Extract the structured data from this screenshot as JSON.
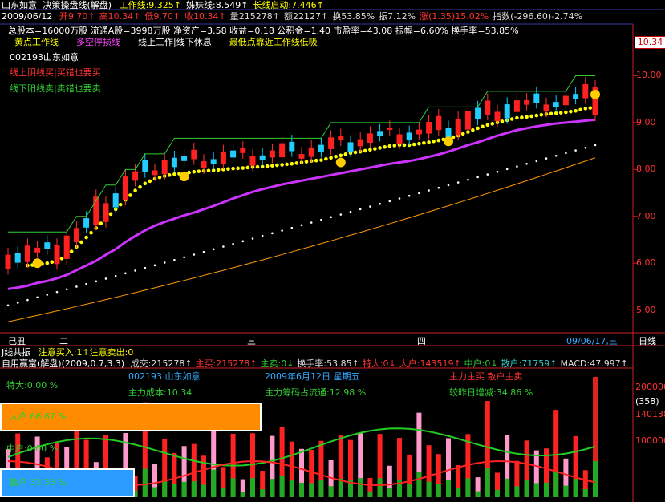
{
  "header": {
    "line1": {
      "stock": "山东如意",
      "indicator": "决策操盘线(解盘)",
      "items": [
        {
          "label": "工作线:",
          "value": "9.325↑",
          "color": "#ffff00"
        },
        {
          "label": "姊妹线:",
          "value": "8.549↑",
          "color": "#ffffff"
        },
        {
          "label": "长线启动:",
          "value": "7.446↑",
          "color": "#ffff00"
        }
      ]
    },
    "line2": "2009/06/12",
    "line2_items": [
      {
        "text": "开9.70↑",
        "color": "#ff3333"
      },
      {
        "text": "高10.34↑",
        "color": "#ff3333"
      },
      {
        "text": "低9.70↑",
        "color": "#ff3333"
      },
      {
        "text": "收10.34↑",
        "color": "#ff3333"
      },
      {
        "text": "量215278↑",
        "color": "#dddddd"
      },
      {
        "text": "额22127↑",
        "color": "#dddddd"
      },
      {
        "text": "换53.85%",
        "color": "#dddddd"
      },
      {
        "text": "振7.12%",
        "color": "#dddddd"
      },
      {
        "text": "涨(1.35)15.02%",
        "color": "#ff3333"
      },
      {
        "text": "指数(-296.60)-2.74%",
        "color": "#dddddd"
      }
    ],
    "line3": "总股本=16000万股  流通A股=3998万股  净资产=3.58  收益=0.18  公积金=1.40  市盈率=43.08  振幅=6.60%  换手率=53.85%",
    "line4": [
      {
        "text": "黄点工作线",
        "color": "#ffff00"
      },
      {
        "text": "多空停损线",
        "color": "#ff44ff"
      },
      {
        "text": "线上工作|线下休息",
        "color": "#ffffff"
      },
      {
        "text": "最低点靠近工作线低吸",
        "color": "#ffff00"
      }
    ],
    "stock_code": "002193山东如意",
    "hint_red": "线上阴线买|买错也要买",
    "hint_green": "线下阳线卖|卖错也要卖"
  },
  "right_axis": {
    "labels": [
      "10.00",
      "9.00",
      "8.00",
      "7.00",
      "6.00",
      "5.00"
    ],
    "price_tag": "10.34"
  },
  "time_axis": {
    "labels": [
      "己丑",
      "二",
      "三",
      "四",
      "09/06/17,三",
      "日线"
    ]
  },
  "panel_title": "J线共振",
  "panel_title_items": "注意买入:1↑注意卖出:0",
  "sub_header": {
    "name": "自用赢富(解盘)(2009,0.7,3.3)",
    "items": [
      {
        "text": "成交:215278↑",
        "color": "#dddddd"
      },
      {
        "text": "主买:215278↑",
        "color": "#ff3333"
      },
      {
        "text": "主卖:0↓",
        "color": "#33cc33"
      },
      {
        "text": "换手率:53.85↑",
        "color": "#dddddd"
      },
      {
        "text": "特大:0↓",
        "color": "#ff3333"
      },
      {
        "text": "大户:143519↑",
        "color": "#ff3333"
      },
      {
        "text": "中户:0↓",
        "color": "#33cc33"
      },
      {
        "text": "散户:71759↑",
        "color": "#33cccc"
      },
      {
        "text": "MACD:47.997↑",
        "color": "#dddddd"
      }
    ]
  },
  "sub_info": {
    "code": "002193 山东如意",
    "date": "2009年6月12日 星期五",
    "tags": "主力主买  散户主卖",
    "cost": "主力成本:10.34",
    "chip": "主力筹码占流通:12.98 %",
    "compare": "较昨日增减:34.86 %"
  },
  "sub_bars": [
    {
      "label": "特大:0.00 %",
      "pct": 0
    },
    {
      "label": "大户 66.67 %",
      "pct": 66.67
    },
    {
      "label": "中户:0.00 %",
      "pct": 0
    },
    {
      "label": "散户 33.33 %",
      "pct": 33.33
    }
  ],
  "sub_axis": {
    "labels": [
      "200000",
      "(358)",
      "140138",
      "100000"
    ]
  },
  "colors": {
    "up": "#ff3333",
    "down": "#00ccff",
    "workline": "#ffff00",
    "stopline": "#cc33ff",
    "orange": "#ff9900",
    "accent": "#ff8c00",
    "retail": "#33aaff"
  },
  "chart_data": {
    "type": "candlestick",
    "ylim": [
      4.6,
      11.0
    ],
    "series": [
      {
        "name": "工作线",
        "values": [
          5.9,
          5.92,
          5.95,
          5.97,
          6.0,
          6.05,
          6.15,
          6.35,
          6.55,
          6.75,
          6.95,
          7.15,
          7.35,
          7.55,
          7.7,
          7.8,
          7.86,
          7.9,
          7.92,
          7.95,
          7.97,
          7.98,
          8.0,
          8.02,
          8.03,
          8.05,
          8.06,
          8.08,
          8.1,
          8.12,
          8.15,
          8.18,
          8.2,
          8.25,
          8.3,
          8.35,
          8.38,
          8.42,
          8.46,
          8.5,
          8.52,
          8.52,
          8.55,
          8.58,
          8.62,
          8.66,
          8.72,
          8.8,
          8.88,
          8.95,
          9.0,
          9.05,
          9.1,
          9.12,
          9.15,
          9.18,
          9.2,
          9.22,
          9.25,
          9.3,
          9.325
        ]
      },
      {
        "name": "多空停损线",
        "values": [
          5.45,
          5.48,
          5.52,
          5.58,
          5.62,
          5.68,
          5.75,
          5.85,
          5.95,
          6.05,
          6.18,
          6.3,
          6.45,
          6.58,
          6.7,
          6.8,
          6.88,
          6.95,
          7.02,
          7.08,
          7.15,
          7.22,
          7.3,
          7.38,
          7.45,
          7.52,
          7.58,
          7.63,
          7.68,
          7.72,
          7.76,
          7.8,
          7.84,
          7.88,
          7.92,
          7.96,
          8.0,
          8.04,
          8.08,
          8.12,
          8.15,
          8.18,
          8.22,
          8.27,
          8.32,
          8.38,
          8.45,
          8.52,
          8.58,
          8.65,
          8.72,
          8.78,
          8.84,
          8.88,
          8.92,
          8.95,
          8.98,
          9.0,
          9.02,
          9.04,
          9.06
        ]
      }
    ]
  }
}
